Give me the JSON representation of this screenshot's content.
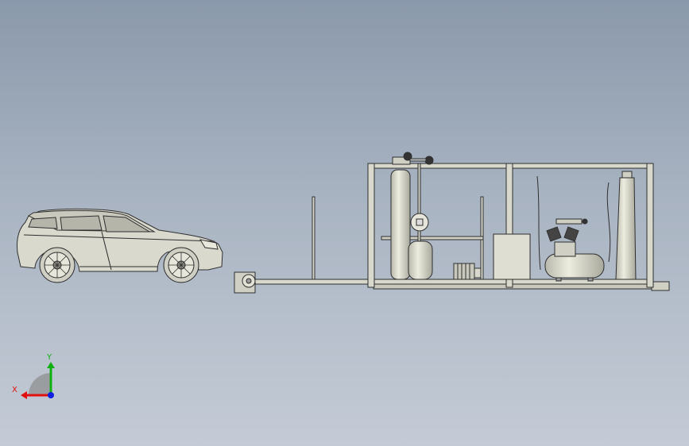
{
  "triad": {
    "x_label": "X",
    "y_label": "Y",
    "x_color": "#e01010",
    "y_color": "#10b010",
    "z_color": "#1020e0"
  },
  "colors": {
    "background_top": "#8a99ab",
    "background_bottom": "#c4cbd6",
    "model_fill": "#d8d8cc",
    "model_stroke": "#333333"
  },
  "icons": {
    "car": "suv-car-icon",
    "plant": "equipment-skid-icon"
  }
}
